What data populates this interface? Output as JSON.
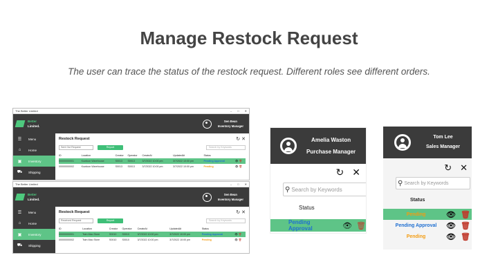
{
  "slide": {
    "title": "Manage Restock Request",
    "subtitle": "The user can trace the status of the restock request. Different roles see different orders."
  },
  "colors": {
    "accent_green": "#5ec487",
    "dark_header": "#3b3b3b",
    "pending_approval": "#1f6fd1",
    "pending": "#f39c12",
    "delete": "#c0392b"
  },
  "window1": {
    "window_title": "The Better Limited",
    "brand_line1": "Better",
    "brand_line2": "Limited.",
    "user_name": "Sen Bean",
    "user_role": "Inventory Manager",
    "sidebar": [
      {
        "icon": "menu-icon",
        "label": "Menu"
      },
      {
        "icon": "home-icon",
        "label": "Home"
      },
      {
        "icon": "inventory-icon",
        "label": "Inventory"
      },
      {
        "icon": "shipping-icon",
        "label": "Shipping"
      }
    ],
    "page_title": "Restock Request",
    "select_value": "Sent Out Request",
    "button_label": "Report",
    "search_placeholder": "Search by Keywords",
    "columns": [
      "ID",
      "Location",
      "Creator",
      "Operator",
      "CreateAt",
      "UpdatedAt",
      "Status"
    ],
    "rows": [
      {
        "id": "00000000001",
        "location": "Kowloon Warehouse",
        "creator": "S0013",
        "operator": "S0013",
        "created": "3/7/2022 10:00 pm",
        "updated": "3/7/2022 10:00 pm",
        "status": "Pending Approval"
      },
      {
        "id": "00000000002",
        "location": "Kowloon Warehouse",
        "creator": "S0013",
        "operator": "S0013",
        "created": "3/7/2022 10:00 pm",
        "updated": "3/7/2022 10:00 pm",
        "status": "Pending"
      }
    ]
  },
  "window2": {
    "window_title": "The Better Limited",
    "brand_line1": "Better",
    "brand_line2": "Limited.",
    "user_name": "Sen Bean",
    "user_role": "Inventory Manager",
    "sidebar": [
      {
        "icon": "menu-icon",
        "label": "Menu"
      },
      {
        "icon": "home-icon",
        "label": "Home"
      },
      {
        "icon": "inventory-icon",
        "label": "Inventory"
      },
      {
        "icon": "shipping-icon",
        "label": "Shipping"
      }
    ],
    "page_title": "Restock Request",
    "select_value": "Received Request",
    "button_label": "Report",
    "search_placeholder": "Search by Keywords",
    "columns": [
      "ID",
      "Location",
      "Creator",
      "Operator",
      "CreateAt",
      "UpdatedAt",
      "Status"
    ],
    "rows": [
      {
        "id": "00000000001",
        "location": "Tsim Mao Store",
        "creator": "S0010",
        "operator": "S0010",
        "created": "3/7/2022 10:00 pm",
        "updated": "3/7/2022 10:00 pm",
        "status": "Pending Approval"
      },
      {
        "id": "00000000002",
        "location": "Tsim Mao Store",
        "creator": "S0010",
        "operator": "S0010",
        "created": "3/7/2022 10:00 pm",
        "updated": "3/7/2022 10:00 pm",
        "status": "Pending"
      }
    ]
  },
  "crop1": {
    "user_name": "Amelia Waston",
    "user_role": "Purchase Manager",
    "search_placeholder": "Search by Keywords",
    "status_header": "Status",
    "row_status": "Pending Approval"
  },
  "crop2": {
    "user_name": "Tom Lee",
    "user_role": "Sales Manager",
    "search_placeholder": "Search by Keywords",
    "status_header": "Status",
    "rows": [
      "Pending",
      "Pending Approval",
      "Pending"
    ]
  }
}
